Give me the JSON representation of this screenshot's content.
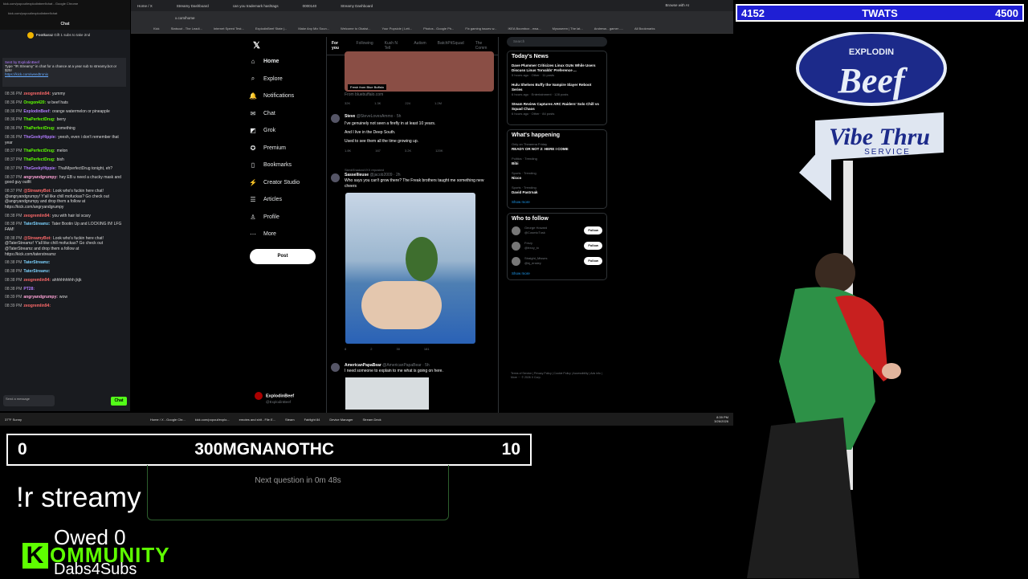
{
  "chat": {
    "url": "kick.com/popout/explodinbeef/chat - Google Chrome",
    "url2": "kick.com/popout/explodinbeef/chat",
    "title": "Chat",
    "gift_user": "FooIkaraz",
    "gift_text": "Gift 1 subs to take 2nd",
    "pinned_by": "Sent by ExplodinBeef",
    "pinned_text": "Type \"!R Streamy\" in chat for a chance at a year sub to streamy.bot or $25!",
    "pinned_link": "https://kick.com/weedtronix",
    "messages": [
      {
        "time": "08:36 PM",
        "user": "zeogremlin94:",
        "color": "#ff6a6a",
        "text": "yummy"
      },
      {
        "time": "08:36 PM",
        "user": "Oregon420:",
        "color": "#5eff00",
        "text": "w beef hats"
      },
      {
        "time": "08:36 PM",
        "user": "ExplodinBeef:",
        "color": "#b27cff",
        "text": "orange watermelon or pineapple"
      },
      {
        "time": "08:36 PM",
        "user": "ThaPerfectDrug:",
        "color": "#5eff00",
        "text": "berry"
      },
      {
        "time": "08:36 PM",
        "user": "ThaPerfectDrug:",
        "color": "#5eff00",
        "text": "something"
      },
      {
        "time": "08:36 PM",
        "user": "TheGeekyHippie:",
        "color": "#b27cff",
        "text": "yeesh, even i don't remember that year"
      },
      {
        "time": "08:37 PM",
        "user": "ThaPerfectDrug:",
        "color": "#5eff00",
        "text": "melon"
      },
      {
        "time": "08:37 PM",
        "user": "ThaPerfectDrug:",
        "color": "#5eff00",
        "text": "bish"
      },
      {
        "time": "08:37 PM",
        "user": "TheGeekyHippie:",
        "color": "#b27cff",
        "text": "ThaIMperfectDrug tonight, eh?"
      },
      {
        "time": "08:37 PM",
        "user": "angryandgrumpy:",
        "color": "#ffa3d6",
        "text": "hey EB u need a chucky mask and good guy outfit"
      },
      {
        "time": "08:37 PM",
        "user": "@StreamyBot:",
        "color": "#ff6a6a",
        "text": "Look who's fuckin here chat! @angryandgrumpy! Y'all like chill mofuckas? Go check out @angryandgrumpy and drop them a follow at https://kick.com/angryandgrumpy"
      },
      {
        "time": "08:38 PM",
        "user": "zeogremlin94:",
        "color": "#ff6a6a",
        "text": "you with hair lol scary"
      },
      {
        "time": "08:38 PM",
        "user": "TaterStreamz:",
        "color": "#7dd3ff",
        "text": "Tater Bootin Up and LOCKING IN! LFG FAM!"
      },
      {
        "time": "08:38 PM",
        "user": "@StreamyBot:",
        "color": "#ff6a6a",
        "text": "Look who's fuckin here chat! @TaterStreamz! Y'all like chill mofuckas? Go check out @TaterStreamz and drop them a follow at https://kick.com/taterstreamz"
      },
      {
        "time": "08:38 PM",
        "user": "TaterStreamz:",
        "color": "#7dd3ff",
        "text": ""
      },
      {
        "time": "08:38 PM",
        "user": "TaterStreamz:",
        "color": "#7dd3ff",
        "text": ""
      },
      {
        "time": "08:38 PM",
        "user": "zeogremlin94:",
        "color": "#ff6a6a",
        "text": "ahhhhhhhhh jkjk"
      },
      {
        "time": "08:38 PM",
        "user": "PT28:",
        "color": "#b27cff",
        "text": ""
      },
      {
        "time": "08:39 PM",
        "user": "angryandgrumpy:",
        "color": "#ffa3d6",
        "text": "wow"
      },
      {
        "time": "08:39 PM",
        "user": "zeogremlin94:",
        "color": "#ff6a6a",
        "text": ""
      }
    ],
    "input_placeholder": "Send a message",
    "chat_button": "Chat"
  },
  "browser": {
    "tabs": [
      "Home / X",
      "Streamy Dashboard",
      "can you trademark hashtags",
      "0000140",
      "Streamy Dashboard"
    ],
    "address": "x.com/home",
    "browse_ai": "Browse with AI",
    "bookmarks": [
      "Kick",
      "Statsout - The Leadi...",
      "Internet Speed Test...",
      "ExplodinBeef State |...",
      "Make Any Mix Soun...",
      "Welcome to Okalwi...",
      "Your Popsicle | Lett...",
      "Photos - Google Ph...",
      "Fix gaming issues w...",
      "IKEA Boombox - ewa...",
      "Mysoseem | The lat...",
      "Andrews - gamer -...",
      "All Bookmarks"
    ]
  },
  "xnav": {
    "logo": "𝕏",
    "items": [
      {
        "icon": "⌂",
        "label": "Home"
      },
      {
        "icon": "⌕",
        "label": "Explore"
      },
      {
        "icon": "🔔",
        "label": "Notifications"
      },
      {
        "icon": "✉",
        "label": "Chat"
      },
      {
        "icon": "◩",
        "label": "Grok"
      },
      {
        "icon": "✪",
        "label": "Premium"
      },
      {
        "icon": "▯",
        "label": "Bookmarks"
      },
      {
        "icon": "⚡",
        "label": "Creator Studio"
      },
      {
        "icon": "☰",
        "label": "Articles"
      },
      {
        "icon": "♙",
        "label": "Profile"
      },
      {
        "icon": "⋯",
        "label": "More"
      }
    ],
    "post": "Post",
    "profile_name": "ExplodinBeef",
    "profile_handle": "@ExplodinBeef"
  },
  "feed": {
    "tabs": [
      "For you",
      "Following",
      "Kush N Tell",
      "Autism",
      "BatchPitSquad",
      "The Comm"
    ],
    "ad_label": "Fresh from Blue Buffalo",
    "ad_source": "From bluebuffalo.com",
    "ad_stats": [
      "32K",
      "1.3K",
      "224",
      "1.2M"
    ],
    "post1": {
      "name": "Steve",
      "handle": "@SteveLovesAmmo · 5h",
      "lines": [
        "I've genuinely not seen a firefly in at least 10 years.",
        "And I live in the Deep South.",
        "Used to see them all the time growing up."
      ],
      "stats": [
        "1.8K",
        "167",
        "3.2K",
        "120K"
      ]
    },
    "post2": {
      "repost": "SkinkShadowVXX reposted",
      "name": "Sassellieuse",
      "handle": "@jacob2009 · 2h",
      "lines": [
        "Who says you can't grow there? The Freak brothers taught me something new cheers"
      ],
      "stats": [
        "8",
        "2",
        "30",
        "181"
      ]
    },
    "post3": {
      "name": "AmericanPapaBear",
      "handle": "@AmericanPapaBear · 5h",
      "lines": [
        "I need someone to explain to me what is going on here."
      ]
    }
  },
  "right": {
    "search_placeholder": "Search",
    "news_title": "Today's News",
    "news": [
      {
        "t": "Dave Plummer Criticizes Linux GUIs While Users Discuss Linus Torvalds' Preference ...",
        "m": "5 hours ago · Other · 11 posts"
      },
      {
        "t": "Hulu Shelves Buffy the Vampire Slayer Reboot Series",
        "m": "6 hours ago · Entertainment · 128 posts"
      },
      {
        "t": "Steam Review Captures ARC Raiders' Solo Chill vs Squad Chaos",
        "m": "6 hours ago · Other · 84 posts"
      }
    ],
    "happening_title": "What's happening",
    "trends": [
      {
        "c": "Only on Thearena Friday",
        "t": "READY OR NOT 2: HERE I COME"
      },
      {
        "c": "Politics · Trending",
        "t": "Bibi"
      },
      {
        "c": "Sports · Trending",
        "t": "Nicco"
      },
      {
        "c": "Sports · Trending",
        "t": "David Pastrnak"
      }
    ],
    "show_more": "Show more",
    "follow_title": "Who to follow",
    "follows": [
      {
        "name": "George Howard",
        "handle": "@CosmicTusk"
      },
      {
        "name": "Frezy",
        "handle": "@frezy_tx"
      },
      {
        "name": "Straight_Misses",
        "handle": "@kj_ensley"
      }
    ],
    "follow_btn": "Follow",
    "footer": "Terms of Service | Privacy Policy | Cookie Policy | Accessibility | Ads info | More ··· © 2026 X Corp."
  },
  "taskbar": {
    "weather": "37°F Sunny",
    "items": [
      "Home / X - Google Chr...",
      "kick.com/popout/explo...",
      "emotes and shit - File E...",
      "Steam",
      "Fairlight 84",
      "Device Manager",
      "Stream Deck"
    ],
    "time": "8:39 PM",
    "date": "3/26/2026"
  },
  "overlay": {
    "score_left_label": "4152",
    "score_center": "TWATS",
    "score_right": "4500",
    "q_left": "0",
    "q_center": "300MGNANOTHC",
    "q_right": "10",
    "next_question": "Next question in 0m 48s",
    "command": "!r streamy",
    "owed": "Owed 0",
    "kommunity": "OMMUNITY",
    "kommunity_k": "K",
    "dabs": "Dabs4Subs",
    "sign_top": "EXPLODIN",
    "sign_beef": "Beef",
    "sign_vibe": "Vibe Thru",
    "sign_service": "SERVICE"
  }
}
